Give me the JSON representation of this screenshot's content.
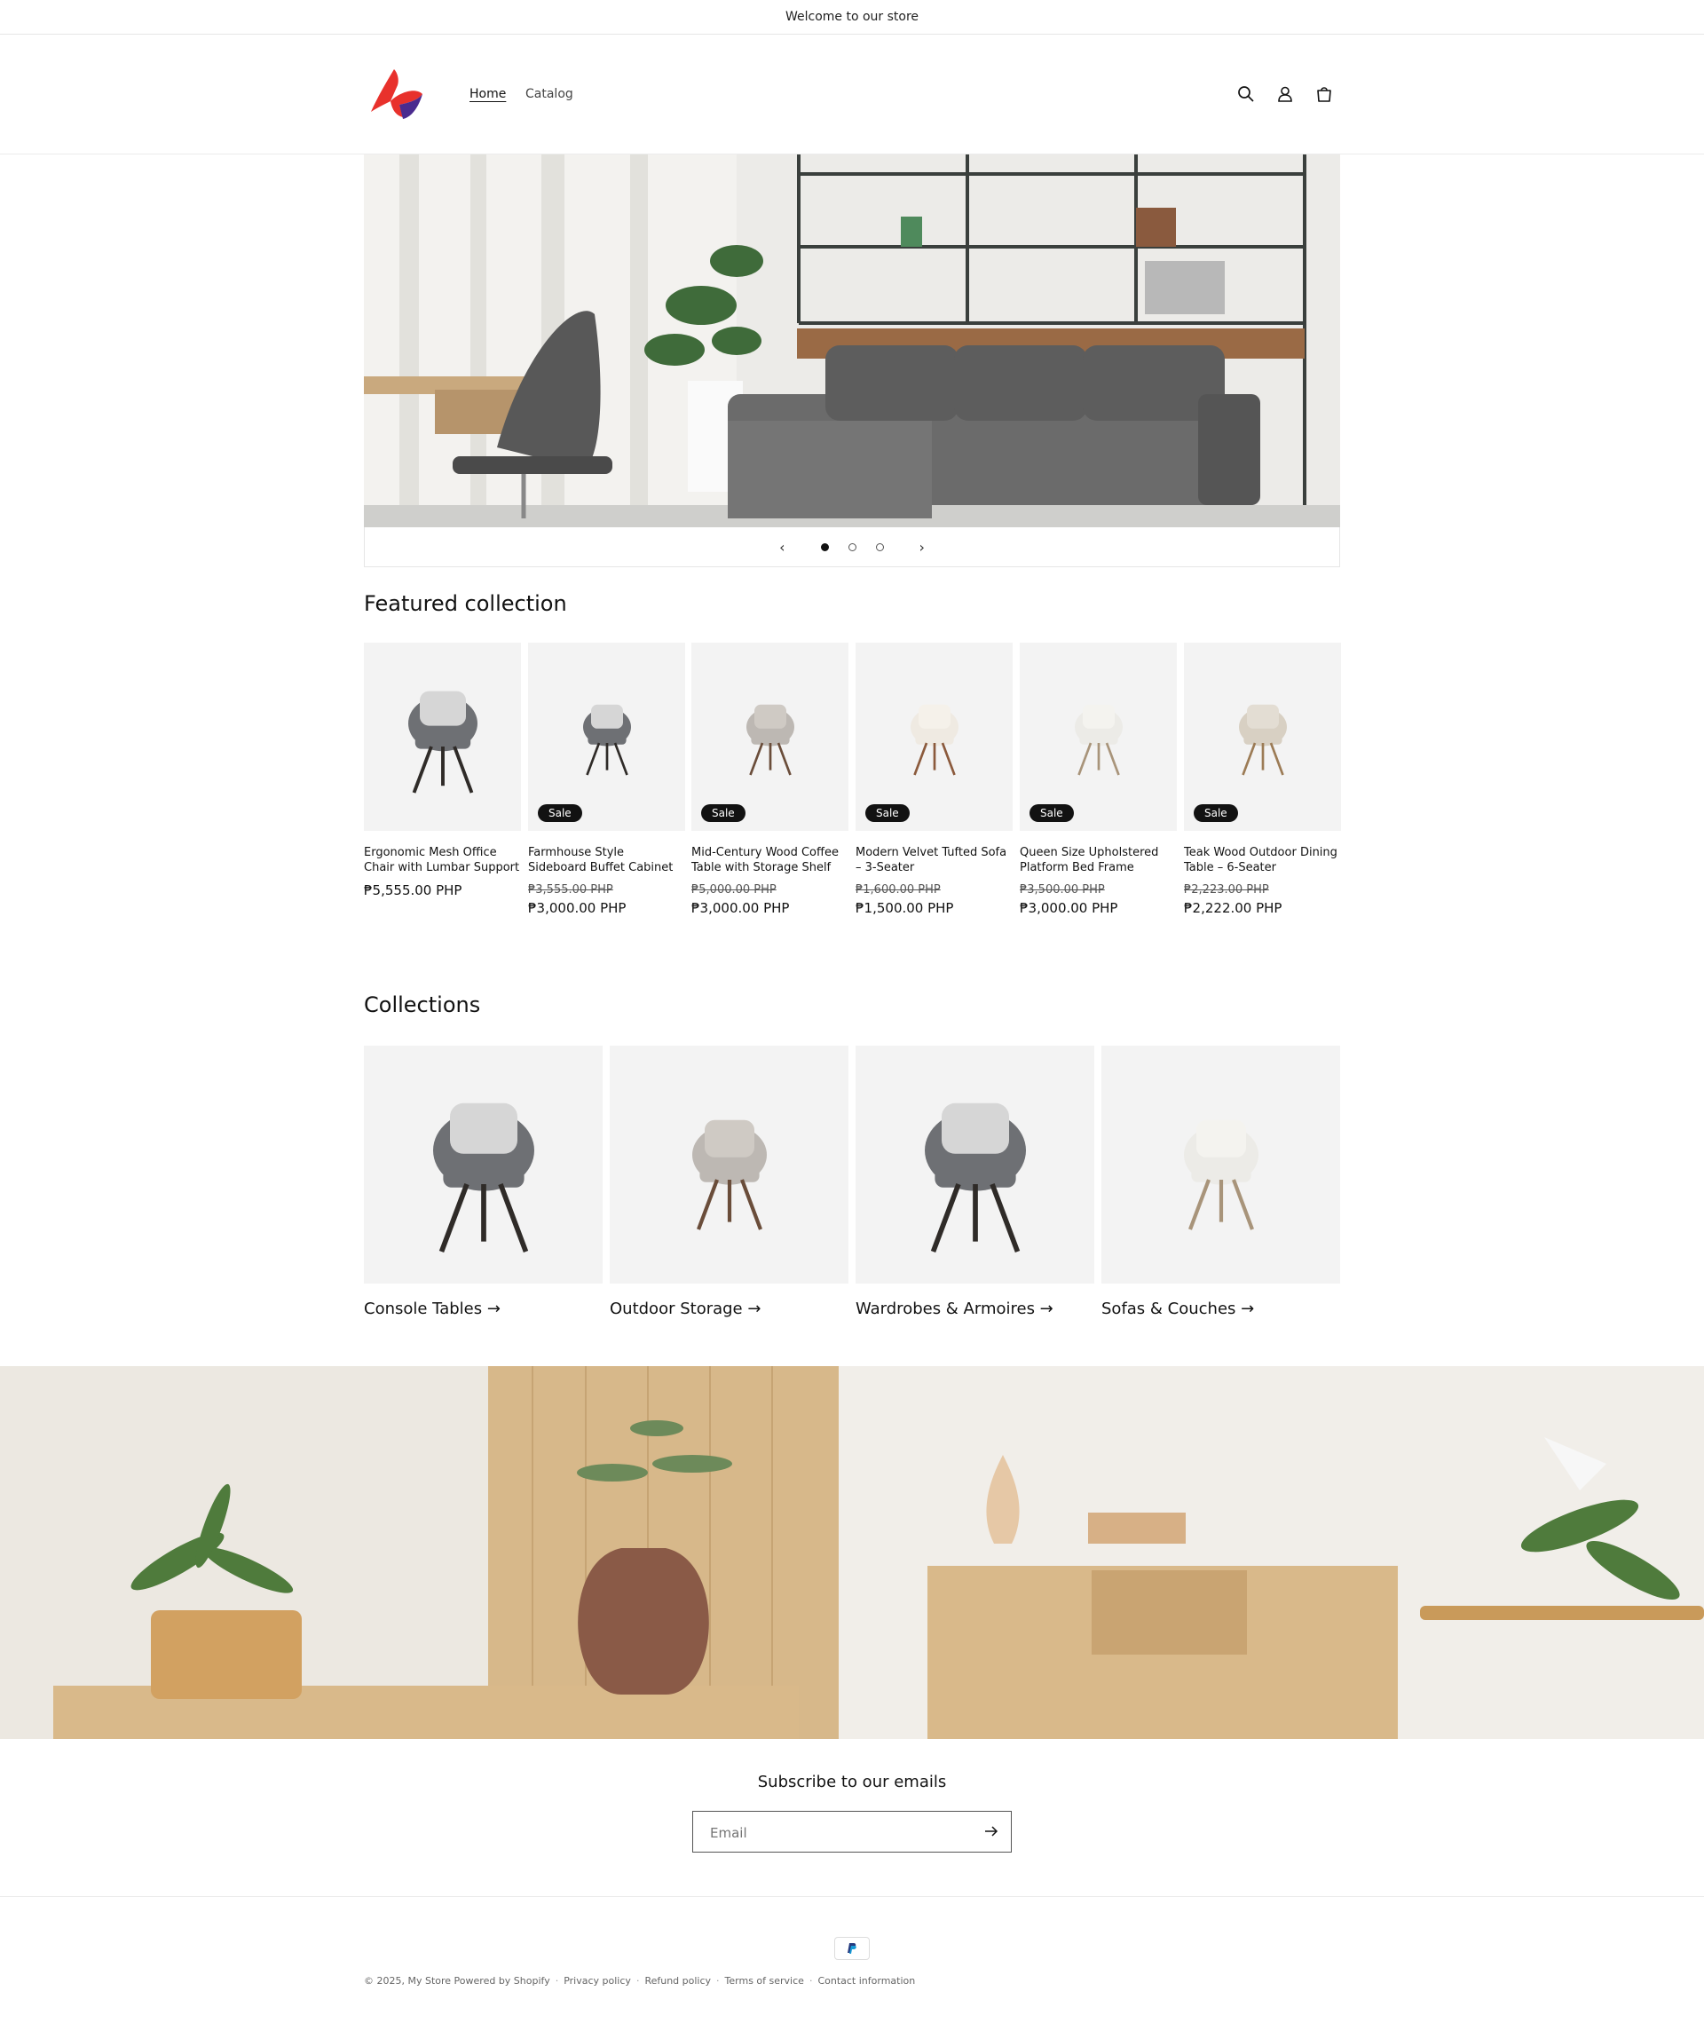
{
  "announcement": "Welcome to our store",
  "nav": {
    "home": "Home",
    "catalog": "Catalog"
  },
  "header_icons": [
    "search-icon",
    "account-icon",
    "cart-icon"
  ],
  "featured": {
    "title": "Featured collection",
    "sale_label": "Sale",
    "products": [
      {
        "title": "Ergonomic Mesh Office Chair with Lumbar Support",
        "price": "₱5,555.00 PHP",
        "compare_at": null,
        "on_sale": false
      },
      {
        "title": "Farmhouse Style Sideboard Buffet Cabinet",
        "price": "₱3,000.00 PHP",
        "compare_at": "₱3,555.00 PHP",
        "on_sale": true
      },
      {
        "title": "Mid-Century Wood Coffee Table with Storage Shelf",
        "price": "₱3,000.00 PHP",
        "compare_at": "₱5,000.00 PHP",
        "on_sale": true
      },
      {
        "title": "Modern Velvet Tufted Sofa – 3-Seater",
        "price": "₱1,500.00 PHP",
        "compare_at": "₱1,600.00 PHP",
        "on_sale": true
      },
      {
        "title": "Queen Size Upholstered Platform Bed Frame",
        "price": "₱3,000.00 PHP",
        "compare_at": "₱3,500.00 PHP",
        "on_sale": true
      },
      {
        "title": "Teak Wood Outdoor Dining Table – 6-Seater",
        "price": "₱2,222.00 PHP",
        "compare_at": "₱2,223.00 PHP",
        "on_sale": true
      }
    ]
  },
  "collections": {
    "title": "Collections",
    "items": [
      {
        "title": "Console Tables →"
      },
      {
        "title": "Outdoor Storage →"
      },
      {
        "title": "Wardrobes & Armoires →"
      },
      {
        "title": "Sofas & Couches →"
      }
    ]
  },
  "slideshow": {
    "active_slide": 1,
    "slide_count": 3
  },
  "newsletter": {
    "title": "Subscribe to our emails",
    "placeholder": "Email"
  },
  "footer": {
    "copyright": "© 2025, My Store Powered by Shopify",
    "links": [
      "Privacy policy",
      "Refund policy",
      "Terms of service",
      "Contact information"
    ]
  },
  "colors": {
    "accent": "#121212",
    "logo_red": "#e8312c",
    "logo_purple": "#4a2b8f",
    "sofa_gray": "#6b6b6b"
  }
}
